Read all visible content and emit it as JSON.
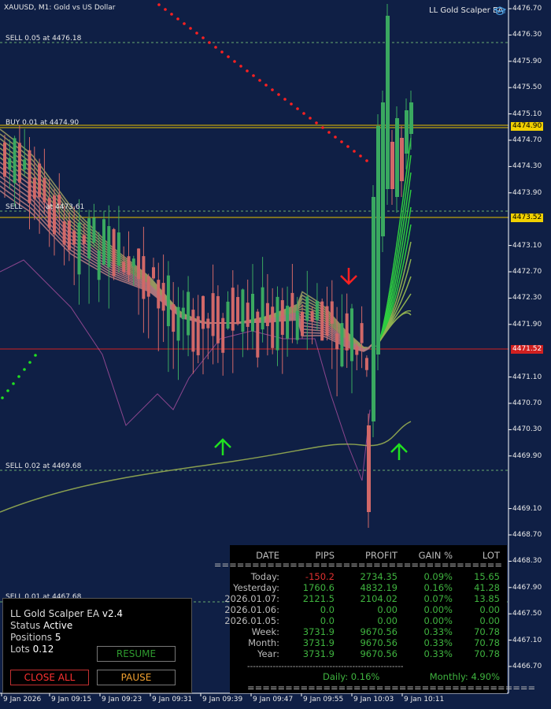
{
  "header": {
    "symbol_title": "XAUUSD, M1:  Gold vs US Dollar",
    "ea_name": "LL Gold Scalper EA"
  },
  "price_scale": [
    "4476.70",
    "4476.30",
    "4475.90",
    "4475.50",
    "4475.10",
    "4474.70",
    "4474.30",
    "4473.90",
    "4473.10",
    "4472.70",
    "4472.30",
    "4471.90",
    "4471.10",
    "4470.70",
    "4470.30",
    "4469.90",
    "4469.10",
    "4468.70",
    "4468.30",
    "4467.90",
    "4467.50",
    "4467.10",
    "4466.70"
  ],
  "time_scale": [
    "9 Jan 2026",
    "9 Jan 09:15",
    "9 Jan 09:23",
    "9 Jan 09:31",
    "9 Jan 09:39",
    "9 Jan 09:47",
    "9 Jan 09:55",
    "9 Jan 10:03",
    "9 Jan 10:11"
  ],
  "price_tags": {
    "ask": "4474.90",
    "bid": "4473.52",
    "red_line": "4471.52"
  },
  "levels": {
    "sell_top": "SELL 0.05 at 4476.18",
    "buy": "BUY 0.01 at 4474.90",
    "sell_mid_prefix": "SELL ",
    "sell_mid_suffix": " at 4473.61",
    "sell_low": "SELL 0.02 at 4469.68",
    "sell_bottom": "SELL 0.01 at 4467.68"
  },
  "colors": {
    "background": "#0f1f45",
    "bull": "#3aa860",
    "bear": "#d16868",
    "dots": "#ff2020",
    "dots_green": "#20e020",
    "ask_line": "#e8c200",
    "red_line": "#d02020"
  },
  "ea_panel": {
    "title": "LL Gold Scalper EA",
    "version": "v2.4",
    "status_label": "Status",
    "status_value": "Active",
    "positions_label": "Positions",
    "positions_value": "5",
    "lots_label": "Lots",
    "lots_value": "0.12",
    "resume": "RESUME",
    "close_all": "CLOSE ALL",
    "pause": "PAUSE"
  },
  "stats": {
    "headers": [
      "DATE",
      "PIPS",
      "PROFIT",
      "GAIN %",
      "LOT"
    ],
    "separator": "======================================",
    "rows": [
      [
        "Today:",
        "-150.2",
        "2734.35",
        "0.09%",
        "15.65"
      ],
      [
        "Yesterday:",
        "1760.6",
        "4832.19",
        "0.16%",
        "41.28"
      ],
      [
        "2026.01.07:",
        "2121.5",
        "2104.02",
        "0.07%",
        "13.85"
      ],
      [
        "2026.01.06:",
        "0.0",
        "0.00",
        "0.00%",
        "0.00"
      ],
      [
        "2026.01.05:",
        "0.0",
        "0.00",
        "0.00%",
        "0.00"
      ],
      [
        "Week:",
        "3731.9",
        "9670.56",
        "0.33%",
        "70.78"
      ],
      [
        "Month:",
        "3731.9",
        "9670.56",
        "0.33%",
        "70.78"
      ],
      [
        "Year:",
        "3731.9",
        "9670.56",
        "0.33%",
        "70.78"
      ]
    ],
    "dash": "-------------------------------------------------------",
    "daily": "Daily: 0.16%",
    "monthly": "Monthly: 4.90%"
  }
}
